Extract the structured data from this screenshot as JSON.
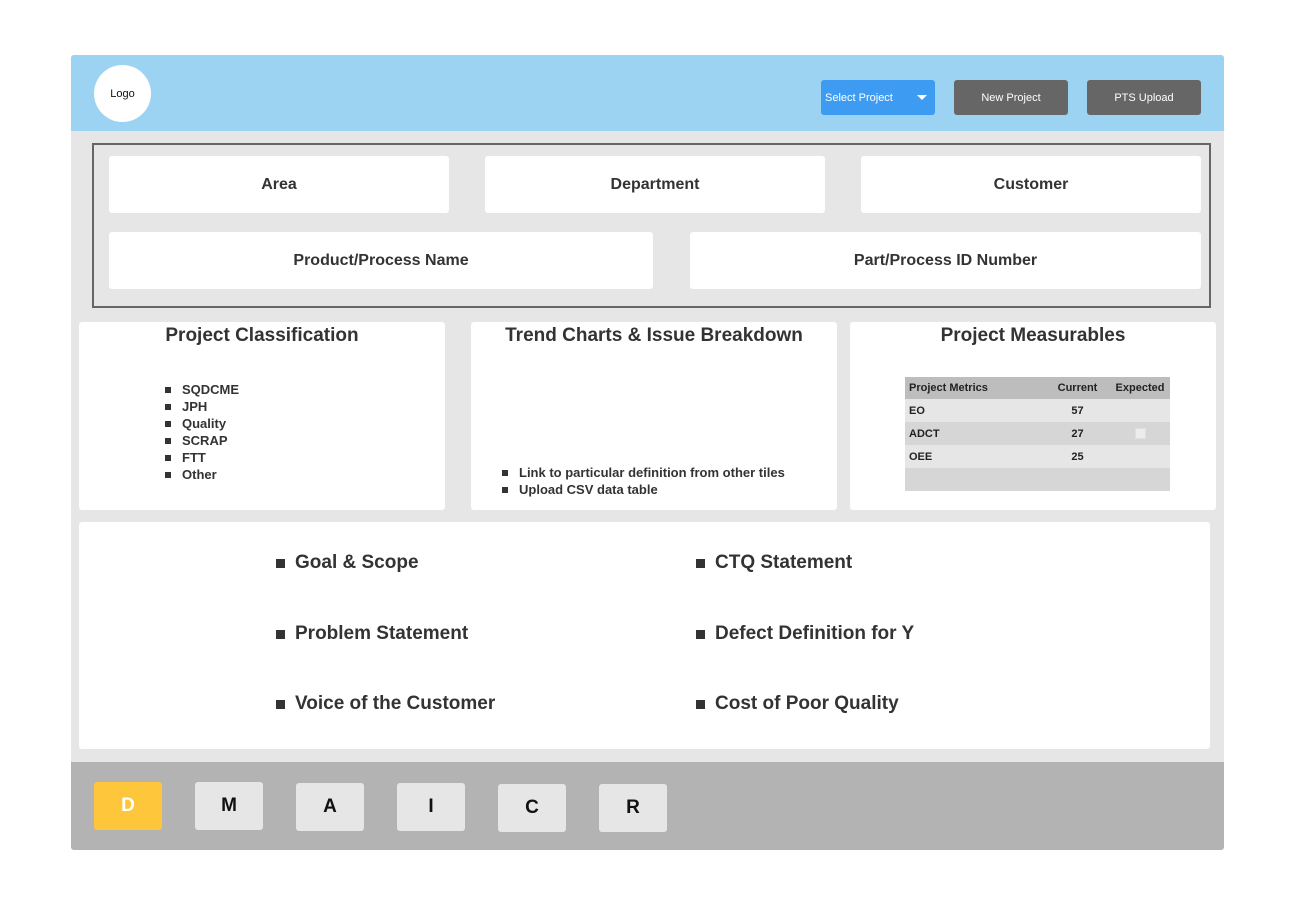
{
  "header": {
    "logo_label": "Logo",
    "select_project_label": "Select Project",
    "new_project_label": "New Project",
    "pts_upload_label": "PTS Upload",
    "background_color": "#9dd3f2",
    "select_color": "#3d9cf2"
  },
  "info": {
    "area_label": "Area",
    "department_label": "Department",
    "customer_label": "Customer",
    "product_label": "Product/Process Name",
    "part_id_label": "Part/Process ID Number"
  },
  "classification": {
    "title": "Project Classification",
    "items": [
      "SQDCME",
      "JPH",
      "Quality",
      "SCRAP",
      "FTT",
      "Other"
    ]
  },
  "trend": {
    "title": "Trend Charts & Issue Breakdown",
    "items": [
      "Link to particular definition from other tiles",
      "Upload CSV data table"
    ]
  },
  "measurables": {
    "title": "Project Measurables",
    "columns": [
      "Project Metrics",
      "Current",
      "Expected"
    ],
    "rows": [
      {
        "metric": "EO",
        "current": "57",
        "expected": ""
      },
      {
        "metric": "ADCT",
        "current": "27",
        "expected": ""
      },
      {
        "metric": "OEE",
        "current": "25",
        "expected": ""
      }
    ]
  },
  "define": {
    "left_items": [
      "Goal & Scope",
      "Problem Statement",
      "Voice of the Customer"
    ],
    "right_items": [
      "CTQ Statement",
      "Defect Definition for Y",
      "Cost of Poor Quality"
    ]
  },
  "phases": {
    "items": [
      "D",
      "M",
      "A",
      "I",
      "C",
      "R"
    ],
    "active": "D",
    "active_color": "#fdc63b"
  }
}
